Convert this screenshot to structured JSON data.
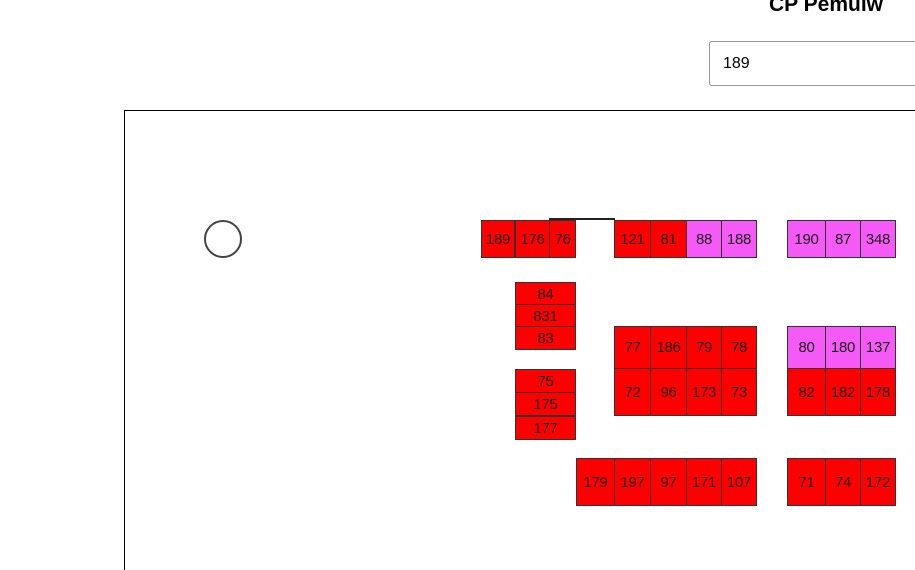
{
  "header": {
    "title": "CP Pemulw"
  },
  "search": {
    "value": "189"
  },
  "colors": {
    "red": "#ff0000",
    "pink": "#f65af6"
  },
  "slots": [
    {
      "id": "189",
      "color": "red"
    },
    {
      "id": "176",
      "color": "red"
    },
    {
      "id": "76",
      "color": "red"
    },
    {
      "id": "121",
      "color": "red"
    },
    {
      "id": "81",
      "color": "red"
    },
    {
      "id": "88",
      "color": "pink"
    },
    {
      "id": "188",
      "color": "pink"
    },
    {
      "id": "190",
      "color": "pink"
    },
    {
      "id": "87",
      "color": "pink"
    },
    {
      "id": "348",
      "color": "pink"
    },
    {
      "id": "84",
      "color": "red"
    },
    {
      "id": "831",
      "color": "red"
    },
    {
      "id": "83",
      "color": "red"
    },
    {
      "id": "77",
      "color": "red"
    },
    {
      "id": "186",
      "color": "red"
    },
    {
      "id": "79",
      "color": "red"
    },
    {
      "id": "78",
      "color": "red"
    },
    {
      "id": "80",
      "color": "pink"
    },
    {
      "id": "180",
      "color": "pink"
    },
    {
      "id": "137",
      "color": "pink"
    },
    {
      "id": "75",
      "color": "red"
    },
    {
      "id": "175",
      "color": "red"
    },
    {
      "id": "177",
      "color": "red"
    },
    {
      "id": "72",
      "color": "red"
    },
    {
      "id": "96",
      "color": "red"
    },
    {
      "id": "173",
      "color": "red"
    },
    {
      "id": "73",
      "color": "red"
    },
    {
      "id": "82",
      "color": "red"
    },
    {
      "id": "182",
      "color": "red"
    },
    {
      "id": "178",
      "color": "red"
    },
    {
      "id": "179",
      "color": "red"
    },
    {
      "id": "197",
      "color": "red"
    },
    {
      "id": "97",
      "color": "red"
    },
    {
      "id": "171",
      "color": "red"
    },
    {
      "id": "107",
      "color": "red"
    },
    {
      "id": "71",
      "color": "red"
    },
    {
      "id": "74",
      "color": "red"
    },
    {
      "id": "172",
      "color": "red"
    }
  ]
}
